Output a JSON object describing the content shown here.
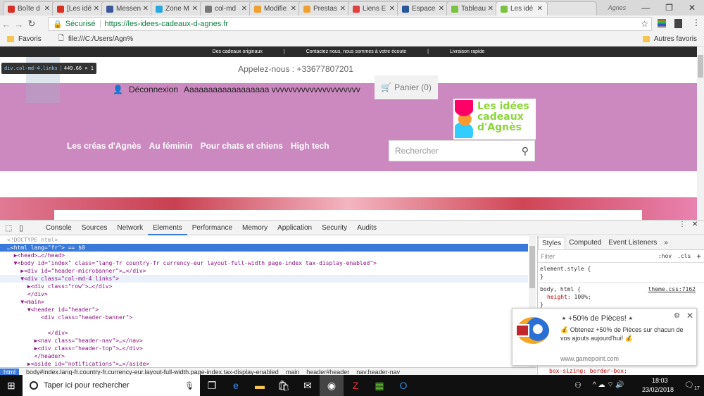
{
  "browser": {
    "tabs": [
      {
        "label": "Boîte d",
        "icon_color": "#d93025"
      },
      {
        "label": "[Les idé",
        "icon_color": "#d93025"
      },
      {
        "label": "Messen",
        "icon_color": "#3b5998"
      },
      {
        "label": "Zone M",
        "icon_color": "#29a8e0"
      },
      {
        "label": "col-md",
        "icon_color": "#777777"
      },
      {
        "label": "Modifie",
        "icon_color": "#f0a030"
      },
      {
        "label": "Prestas",
        "icon_color": "#f0a030"
      },
      {
        "label": "Liens E",
        "icon_color": "#e04040"
      },
      {
        "label": "Espace",
        "icon_color": "#2b579a"
      },
      {
        "label": "Tableau",
        "icon_color": "#7cc242"
      },
      {
        "label": "Les idé",
        "icon_color": "#7cc242",
        "active": true
      }
    ],
    "profile": "Agnes",
    "secure_label": "Sécurisé",
    "url": "https://les-idees-cadeaux-d-agnes.fr",
    "bookmarks": {
      "favoris": "Favoris",
      "file": "file:///C:/Users/Agn%",
      "other": "Autres favoris"
    }
  },
  "site": {
    "microbanner": [
      "Des cadeaux originaux",
      "|",
      "Contactez nous, nous sommes à votre écoute",
      "|",
      "Livraison rapide"
    ],
    "phone": "Appelez-nous : +33677807201",
    "logout": "Déconnexion",
    "username": "Aaaaaaaaaaaaaaaaaa vvvvvvvvvvvvvvvvvvvvv",
    "cart": "Panier (0)",
    "logo": [
      "Les idées",
      "cadeaux",
      "d'Agnès"
    ],
    "menu": [
      "Les créas d'Agnès",
      "Au féminin",
      "Pour chats et chiens",
      "High tech"
    ],
    "search_placeholder": "Rechercher",
    "pink": "#cb89bf",
    "inspect_tooltip": {
      "selector": "div.col-md-4.links",
      "size": "449.66 × 1"
    }
  },
  "devtools": {
    "tabs": [
      "Console",
      "Sources",
      "Network",
      "Elements",
      "Performance",
      "Memory",
      "Application",
      "Security",
      "Audits"
    ],
    "active_tab": "Elements",
    "dom": [
      "<!DOCTYPE html>",
      "…<html lang=\"fr\"> == $0",
      "  ▶<head>…</head>",
      "  ▼<body id=\"index\" class=\"lang-fr country-fr currency-eur layout-full-width page-index tax-display-enabled\">",
      "    ▶<div id=\"header-microbanner\">…</div>",
      "    ▼<div class=\"col-md-4 links\">",
      "      ▶<div class=\"row\">…</div>",
      "      </div>",
      "    ▼<main>",
      "      ▼<header id=\"header\">",
      "          <div class=\"header-banner\">",
      "",
      "            </div>",
      "        ▶<nav class=\"header-nav\">…</nav>",
      "        ▶<div class=\"header-top\">…</div>",
      "        </header>",
      "      ▶<aside id=\"notifications\">…</aside>"
    ],
    "styles_tabs": [
      "Styles",
      "Computed",
      "Event Listeners",
      "»"
    ],
    "filter": "Filter",
    "hov": ":hov",
    "cls": ".cls",
    "rules": [
      {
        "selector": "element.style {",
        "close": "}"
      },
      {
        "selector": "body, html {",
        "source": "theme.css:7162",
        "prop": "height",
        "value": "100%;",
        "close": "}"
      }
    ],
    "hidden_prop": "box-sizing: border-box;",
    "breadcrumb": [
      "html",
      "body#index.lang-fr.country-fr.currency-eur.layout-full-width.page-index.tax-display-enabled",
      "main",
      "header#header",
      "nav.header-nav"
    ]
  },
  "notification": {
    "title": "⭑ +50% de Pièces! ⭑",
    "body": "💰 Obtenez +50% de Pièces sur chacun de vos ajouts aujourd'hui! 💰",
    "source": "www.gamepoint.com"
  },
  "taskbar": {
    "search_placeholder": "Taper ici pour rechercher",
    "time": "18:03",
    "date": "23/02/2018",
    "notif_count": "17"
  }
}
